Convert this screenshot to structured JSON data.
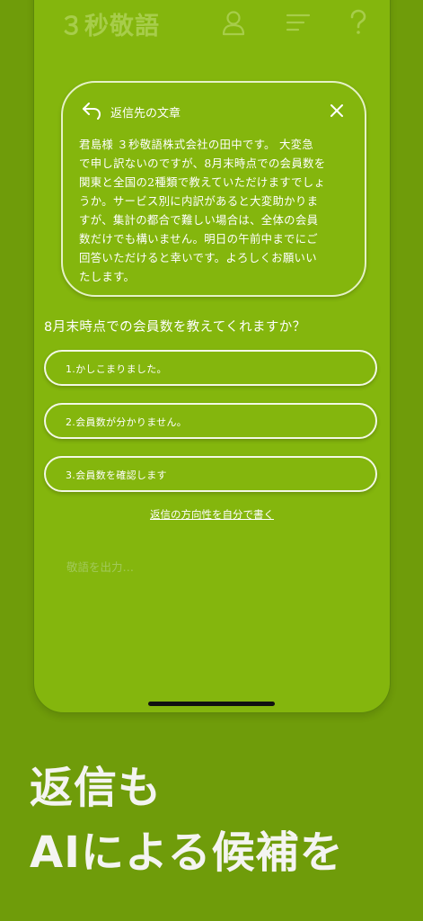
{
  "header": {
    "app_title": "３秒敬語",
    "icons": [
      "user-icon",
      "menu-icon",
      "help-icon"
    ]
  },
  "reply_card": {
    "title": "返信先の文章",
    "body": "君島様 ３秒敬語株式会社の田中です。 大変急\nで申し訳ないのですが、8月末時点での会員数を\n関東と全国の2種類で教えていただけますでしょ\nうか。サービス別に内訳があると大変助かりま\nすが、集計の都合で難しい場合は、全体の会員\n数だけでも構いません。明日の午前中までにご\n回答いただけると幸いです。よろしくお願いい\nたします。"
  },
  "question": "8月末時点での会員数を教えてくれますか？",
  "options": [
    {
      "label": "1.かしこまりました。"
    },
    {
      "label": "2.会員数が分かりません。"
    },
    {
      "label": "3.会員数を確認します"
    }
  ],
  "custom_link": "返信の方向性を自分で書く",
  "output_placeholder": "敬語を出力…",
  "tagline": {
    "line1": "返信も",
    "line2": "AIによる候補を"
  },
  "colors": {
    "background": "#6f9c0a",
    "screen": "#84b60d",
    "text": "#ffffff"
  }
}
